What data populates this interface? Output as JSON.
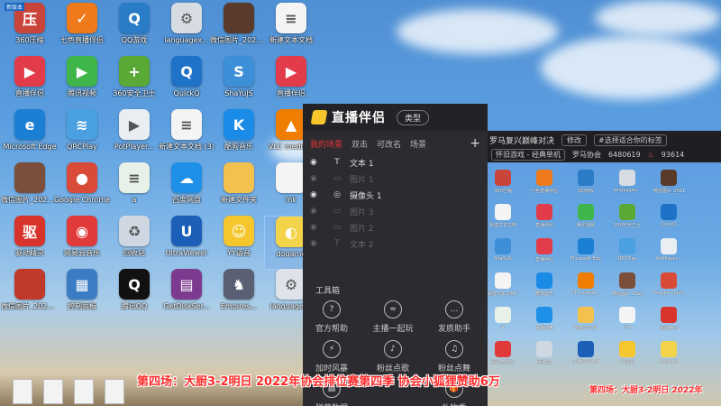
{
  "desktop_icons": [
    {
      "label": "360压缩",
      "icon": "archive-icon",
      "color": "#c9443a",
      "glyph": "压",
      "badge": "新版本"
    },
    {
      "label": "七色直播伴侣",
      "icon": "qise-icon",
      "color": "#ef7a1c",
      "glyph": "✓"
    },
    {
      "label": "QQ游戏",
      "icon": "qq-game-icon",
      "color": "#2a7cc7",
      "glyph": "Q"
    },
    {
      "label": "languagex...",
      "icon": "config-file-icon",
      "color": "#d6dce2",
      "glyph": "⚙"
    },
    {
      "label": "微信图片_2021080...",
      "icon": "image-file-icon",
      "color": "#5a3a2a",
      "glyph": ""
    },
    {
      "label": "新建文本文档",
      "icon": "text-doc-icon",
      "color": "#f4f4f4",
      "glyph": "≡"
    },
    {
      "label": "直播伴侣",
      "icon": "live-assistant-icon",
      "color": "#e23c4a",
      "glyph": "▶"
    },
    {
      "label": "腾讯视频",
      "icon": "tencent-video-icon",
      "color": "#3fb54a",
      "glyph": "▶"
    },
    {
      "label": "360安全卫士",
      "icon": "360-guard-icon",
      "color": "#5aa836",
      "glyph": "+"
    },
    {
      "label": "QuickQ",
      "icon": "quickq-icon",
      "color": "#1e73c8",
      "glyph": "Q"
    },
    {
      "label": "ShaYuJS",
      "icon": "shayujs-icon",
      "color": "#3d8fd8",
      "glyph": "S"
    },
    {
      "label": "直播伴侣",
      "icon": "live-assistant-icon",
      "color": "#e23c4a",
      "glyph": "▶"
    },
    {
      "label": "Microsoft Edge",
      "icon": "edge-icon",
      "color": "#1b7fd4",
      "glyph": "e"
    },
    {
      "label": "QRCPlay",
      "icon": "qrcplay-icon",
      "color": "#4aa0e0",
      "glyph": "≋"
    },
    {
      "label": "PotPlayer...",
      "icon": "potplayer-icon",
      "color": "#e9eef3",
      "glyph": "▶"
    },
    {
      "label": "新建文本文档 (3)",
      "icon": "text-doc-icon",
      "color": "#f4f4f4",
      "glyph": "≡"
    },
    {
      "label": "酷狗音乐",
      "icon": "kugou-icon",
      "color": "#1a8ce8",
      "glyph": "K"
    },
    {
      "label": "VLC media...",
      "icon": "vlc-icon",
      "color": "#ef7d00",
      "glyph": "▲"
    },
    {
      "label": "微信图片_2022040...",
      "icon": "image-file-icon",
      "color": "#7b4f3a",
      "glyph": ""
    },
    {
      "label": "Google Chrome",
      "icon": "chrome-icon",
      "color": "#d94a38",
      "glyph": "●"
    },
    {
      "label": "a",
      "icon": "text-file-icon",
      "color": "#e8f1e8",
      "glyph": "≡"
    },
    {
      "label": "百度网盘",
      "icon": "baidu-netdisk-icon",
      "color": "#1f90e8",
      "glyph": "☁"
    },
    {
      "label": "新建文件夹",
      "icon": "folder-icon",
      "color": "#f2c14e",
      "glyph": ""
    },
    {
      "label": "lnk",
      "icon": "blank-file-icon",
      "color": "#f4f4f4",
      "glyph": ""
    },
    {
      "label": "驱动精灵",
      "icon": "driver-icon",
      "color": "#d8342c",
      "glyph": "驱"
    },
    {
      "label": "网易云音乐",
      "icon": "netease-music-icon",
      "color": "#e03a3a",
      "glyph": "◉"
    },
    {
      "label": "回收站",
      "icon": "recycle-bin-icon",
      "color": "#cfd8e2",
      "glyph": "♻"
    },
    {
      "label": "UltraViewer",
      "icon": "ultraviewer-icon",
      "color": "#1b5fb8",
      "glyph": "U"
    },
    {
      "label": "YY语音",
      "icon": "yy-icon",
      "color": "#f6c62f",
      "glyph": "☺"
    },
    {
      "label": "dogame",
      "icon": "dogame-icon",
      "color": "#f3d34a",
      "glyph": "◐"
    },
    {
      "label": "微信图片_2022010...",
      "icon": "image-file-icon",
      "color": "#c0392b",
      "glyph": ""
    },
    {
      "label": "控制面板",
      "icon": "control-panel-icon",
      "color": "#3b7cc4",
      "glyph": "▦"
    },
    {
      "label": "腾讯QQ",
      "icon": "qq-icon",
      "color": "#111111",
      "glyph": "Q"
    },
    {
      "label": "GetDiskSer...",
      "icon": "winrar-icon",
      "color": "#7c3b8f",
      "glyph": "▤"
    },
    {
      "label": "Empires...",
      "icon": "empires-icon",
      "color": "#5a5f73",
      "glyph": "♞"
    },
    {
      "label": "languagedll",
      "icon": "config-file-icon",
      "color": "#dde3e8",
      "glyph": "⚙"
    }
  ],
  "panel": {
    "logo_text": "直播伴侣",
    "type_label": "类型",
    "scene_tabs": [
      "我的场景",
      "双击",
      "可改名",
      "场景"
    ],
    "sources": [
      {
        "visible": true,
        "kind": "T",
        "name": "文本 1",
        "dim": false
      },
      {
        "visible": false,
        "kind": "▭",
        "name": "图片 1",
        "dim": true
      },
      {
        "visible": true,
        "kind": "◎",
        "name": "摄像头 1",
        "dim": false
      },
      {
        "visible": false,
        "kind": "▭",
        "name": "图片 3",
        "dim": true
      },
      {
        "visible": false,
        "kind": "▭",
        "name": "图片 2",
        "dim": true
      },
      {
        "visible": false,
        "kind": "T",
        "name": "文本 2",
        "dim": true
      }
    ],
    "tools_title": "工具箱",
    "tools": [
      {
        "label": "官方帮助",
        "icon": "help-icon"
      },
      {
        "label": "主播一起玩",
        "icon": "play-together-icon"
      },
      {
        "label": "发质助手",
        "icon": "more-icon"
      },
      {
        "label": "加时风暴",
        "icon": "storm-icon"
      },
      {
        "label": "粉丝点歌",
        "icon": "song-request-icon"
      },
      {
        "label": "粉丝点舞",
        "icon": "dance-request-icon"
      },
      {
        "label": "弹幕数据",
        "icon": "danmaku-data-icon"
      },
      {
        "label": "礼物秀",
        "icon": "gift-show-icon"
      }
    ]
  },
  "stream_bar": {
    "title": "罗马复兴巅峰对决",
    "edit_label": "修改",
    "tag": "#选择适合你的标签",
    "category": "怀旧游戏 - 经典单机",
    "association": "罗马协会",
    "room_id": "6480619",
    "heat": "93614"
  },
  "overlay": {
    "subtitle": "第四场：大厨3-2明日 2022年协会排位赛第四季 协会小狐狸赞助6万",
    "subtitle_preview": "第四场：大厨3-2明日 2022年"
  }
}
